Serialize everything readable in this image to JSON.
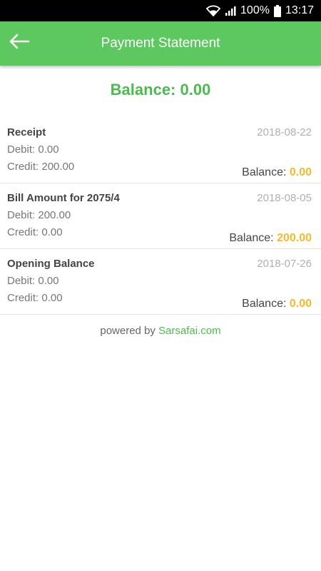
{
  "status_bar": {
    "battery_percent": "100%",
    "time": "13:17",
    "icons": [
      "wifi-icon",
      "signal-icon",
      "battery-icon"
    ]
  },
  "app_bar": {
    "title": "Payment Statement",
    "back_icon": "arrow-left-icon",
    "color": "#5cc85f"
  },
  "summary": {
    "balance_label": "Balance: 0.00"
  },
  "transactions": [
    {
      "title": "Receipt",
      "date": "2018-08-22",
      "debit": "Debit: 0.00",
      "credit": "Credit: 200.00",
      "balance_label": "Balance: ",
      "balance_value": "0.00"
    },
    {
      "title": "Bill Amount for 2075/4",
      "date": "2018-08-05",
      "debit": "Debit: 200.00",
      "credit": "Credit: 0.00",
      "balance_label": "Balance: ",
      "balance_value": "200.00"
    },
    {
      "title": "Opening Balance",
      "date": "2018-07-26",
      "debit": "Debit: 0.00",
      "credit": "Credit: 0.00",
      "balance_label": "Balance: ",
      "balance_value": "0.00"
    }
  ],
  "footer": {
    "powered_text": "powered by ",
    "powered_link": "Sarsafai.com"
  },
  "colors": {
    "accent_green": "#4cbb4f",
    "balance_value_orange": "#f6b92b"
  }
}
